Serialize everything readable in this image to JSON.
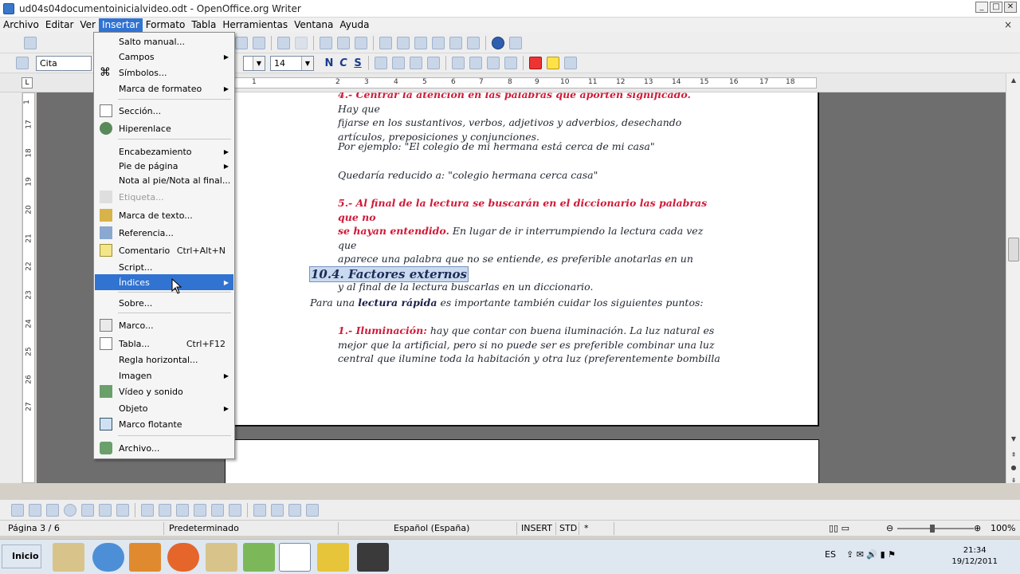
{
  "window": {
    "title": "ud04s04documentoinicialvideo.odt - OpenOffice.org Writer",
    "min": "_",
    "max": "□",
    "close": "✕"
  },
  "menubar": {
    "items": [
      "Archivo",
      "Editar",
      "Ver",
      "Insertar",
      "Formato",
      "Tabla",
      "Herramientas",
      "Ventana",
      "Ayuda"
    ],
    "close": "×"
  },
  "format_toolbar": {
    "style": "Cita",
    "font_size": "14",
    "bold": "N",
    "italic": "C",
    "underline": "S"
  },
  "ruler": {
    "h_labels": [
      "1",
      "1",
      "2",
      "3",
      "4",
      "5",
      "6",
      "7",
      "8",
      "9",
      "10",
      "11",
      "12",
      "13",
      "14",
      "15",
      "16",
      "17",
      "18"
    ],
    "v_labels": [
      "1",
      "17",
      "18",
      "19",
      "20",
      "21",
      "22",
      "23",
      "24",
      "25",
      "26",
      "27"
    ]
  },
  "insert_menu": [
    {
      "label": "Salto manual...",
      "icon": "none",
      "submenu": false
    },
    {
      "label": "Campos",
      "icon": "none",
      "submenu": true
    },
    {
      "label": "Símbolos...",
      "icon": "symbol-icon",
      "submenu": false
    },
    {
      "label": "Marca de formateo",
      "icon": "none",
      "submenu": true
    },
    {
      "label": "Sección...",
      "icon": "section-icon",
      "submenu": false
    },
    {
      "label": "Hiperenlace",
      "icon": "hyperlink-icon",
      "submenu": false
    },
    {
      "label": "Encabezamiento",
      "icon": "none",
      "submenu": true
    },
    {
      "label": "Pie de página",
      "icon": "none",
      "submenu": true
    },
    {
      "label": "Nota al pie/Nota al final...",
      "icon": "none",
      "submenu": false
    },
    {
      "label": "Etiqueta...",
      "icon": "caption-icon",
      "submenu": false,
      "disabled": true
    },
    {
      "label": "Marca de texto...",
      "icon": "bookmark-icon",
      "submenu": false
    },
    {
      "label": "Referencia...",
      "icon": "reference-icon",
      "submenu": false
    },
    {
      "label": "Comentario",
      "icon": "comment-icon",
      "submenu": false,
      "shortcut": "Ctrl+Alt+N"
    },
    {
      "label": "Script...",
      "icon": "none",
      "submenu": false
    },
    {
      "label": "Índices",
      "icon": "none",
      "submenu": true,
      "highlighted": true
    },
    {
      "label": "Sobre...",
      "icon": "none",
      "submenu": false
    },
    {
      "label": "Marco...",
      "icon": "frame-icon",
      "submenu": false
    },
    {
      "label": "Tabla...",
      "icon": "table-icon",
      "submenu": false,
      "shortcut": "Ctrl+F12"
    },
    {
      "label": "Regla horizontal...",
      "icon": "none",
      "submenu": false
    },
    {
      "label": "Imagen",
      "icon": "none",
      "submenu": true
    },
    {
      "label": "Vídeo y sonido",
      "icon": "video-icon",
      "submenu": false
    },
    {
      "label": "Objeto",
      "icon": "none",
      "submenu": true
    },
    {
      "label": "Marco flotante",
      "icon": "floating-frame-icon",
      "submenu": false
    },
    {
      "label": "Archivo...",
      "icon": "file-icon",
      "submenu": false
    }
  ],
  "document": {
    "p4_red": "4.- Centrar la atención en las palabras que aporten significado.",
    "p4_rest_l1": " Hay que",
    "p4_l2": "fijarse en los sustantivos, verbos, adjetivos y adverbios, desechando",
    "p4_l3": "artículos, preposiciones y conjunciones.",
    "ex1": "Por ejemplo: \"El colegio de mi hermana está cerca de mi casa\"",
    "ex2": "Quedaría reducido a: \"colegio hermana cerca casa\"",
    "p5_red_l1": "5.- Al final de la lectura se buscarán en el diccionario las palabras que no",
    "p5_red_l2": "se hayan entendido.",
    "p5_rest_l2": " En lugar de ir interrumpiendo la lectura cada vez que",
    "p5_l3": "aparece una palabra que no se entiende, es preferible anotarlas en un papel",
    "p5_l4": "y al final de la lectura buscarlas en un diccionario.",
    "heading": "10.4. Factores externos",
    "intro_a": "Para una ",
    "intro_b": "lectura rápida",
    "intro_c": " es importante también cuidar los siguientes puntos:",
    "p1_red": "1.- Iluminación:",
    "p1_rest_l1": " hay que contar con buena iluminación. La luz natural es",
    "p1_l2": "mejor que la artificial, pero si no puede ser es preferible combinar una luz",
    "p1_l3": "central que ilumine toda la habitación y otra luz (preferentemente bombilla"
  },
  "status": {
    "page": "Página 3 / 6",
    "style": "Predeterminado",
    "lang": "Español (España)",
    "insert": "INSERT",
    "std": "STD",
    "star": "*",
    "zoom": "100%"
  },
  "taskbar": {
    "start": "Inicio",
    "lang": "ES",
    "time": "21:34",
    "date": "19/12/2011"
  },
  "colors": {
    "menu_highlight": "#3173d1",
    "doc_red": "#d01a38",
    "workspace": "#6e6e6e"
  }
}
